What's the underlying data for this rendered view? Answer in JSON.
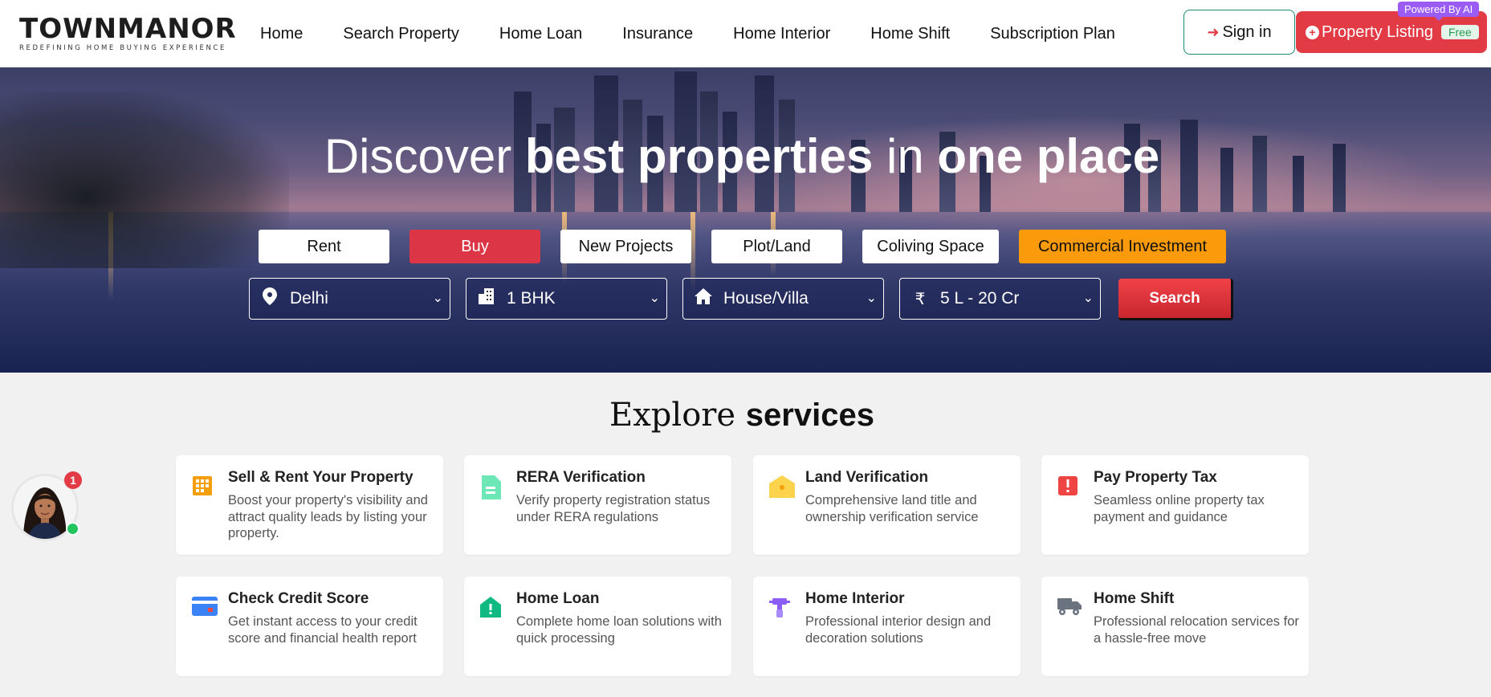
{
  "brand": {
    "name": "TOWNMANOR",
    "tagline": "REDEFINING HOME BUYING EXPERIENCE"
  },
  "nav": [
    {
      "label": "Home"
    },
    {
      "label": "Search Property"
    },
    {
      "label": "Home Loan"
    },
    {
      "label": "Insurance"
    },
    {
      "label": "Home Interior"
    },
    {
      "label": "Home Shift"
    },
    {
      "label": "Subscription Plan"
    }
  ],
  "header": {
    "signin_label": "Sign in",
    "listing_label": "Property Listing",
    "free_badge": "Free",
    "powered_label": "Powered By AI"
  },
  "hero": {
    "title_parts": [
      "Discover ",
      "best properties",
      " in ",
      "one place"
    ],
    "tabs": [
      "Rent",
      "Buy",
      "New Projects",
      "Plot/Land",
      "Coliving Space",
      "Commercial Investment"
    ],
    "active_tab": "Buy",
    "filters": {
      "city": "Delhi",
      "bhk": "1 BHK",
      "type": "House/Villa",
      "budget": "5 L - 20 Cr"
    },
    "currency_symbol": "₹",
    "search_label": "Search"
  },
  "services": {
    "title_serif": "Explore ",
    "title_bold": "services",
    "items": [
      {
        "title": "Sell & Rent Your Property",
        "desc": "Boost your property's visibility and attract quality leads by listing your property.",
        "icon": "grid-icon",
        "color": "#f59e0b"
      },
      {
        "title": "RERA Verification",
        "desc": "Verify property registration status under RERA regulations",
        "icon": "document-icon",
        "color": "#6ee7b7"
      },
      {
        "title": "Land Verification",
        "desc": "Comprehensive land title and ownership verification service",
        "icon": "land-icon",
        "color": "#fcd34d"
      },
      {
        "title": "Pay Property Tax",
        "desc": "Seamless online property tax payment and guidance",
        "icon": "alert-icon",
        "color": "#ef4444"
      },
      {
        "title": "Check Credit Score",
        "desc": "Get instant access to your credit score and financial health report",
        "icon": "credit-card-icon",
        "color": "#3b82f6"
      },
      {
        "title": "Home Loan",
        "desc": "Complete home loan solutions with quick processing",
        "icon": "home-alert-icon",
        "color": "#10b981"
      },
      {
        "title": "Home Interior",
        "desc": "Professional interior design and decoration solutions",
        "icon": "paint-roller-icon",
        "color": "#8b5cf6"
      },
      {
        "title": "Home Shift",
        "desc": "Professional relocation services for a hassle-free move",
        "icon": "truck-icon",
        "color": "#6b7280"
      }
    ]
  },
  "chat": {
    "badge_count": "1"
  },
  "colors": {
    "accent": "#e23b45",
    "orange": "#fb9a0b",
    "teal": "#1a8a78"
  }
}
